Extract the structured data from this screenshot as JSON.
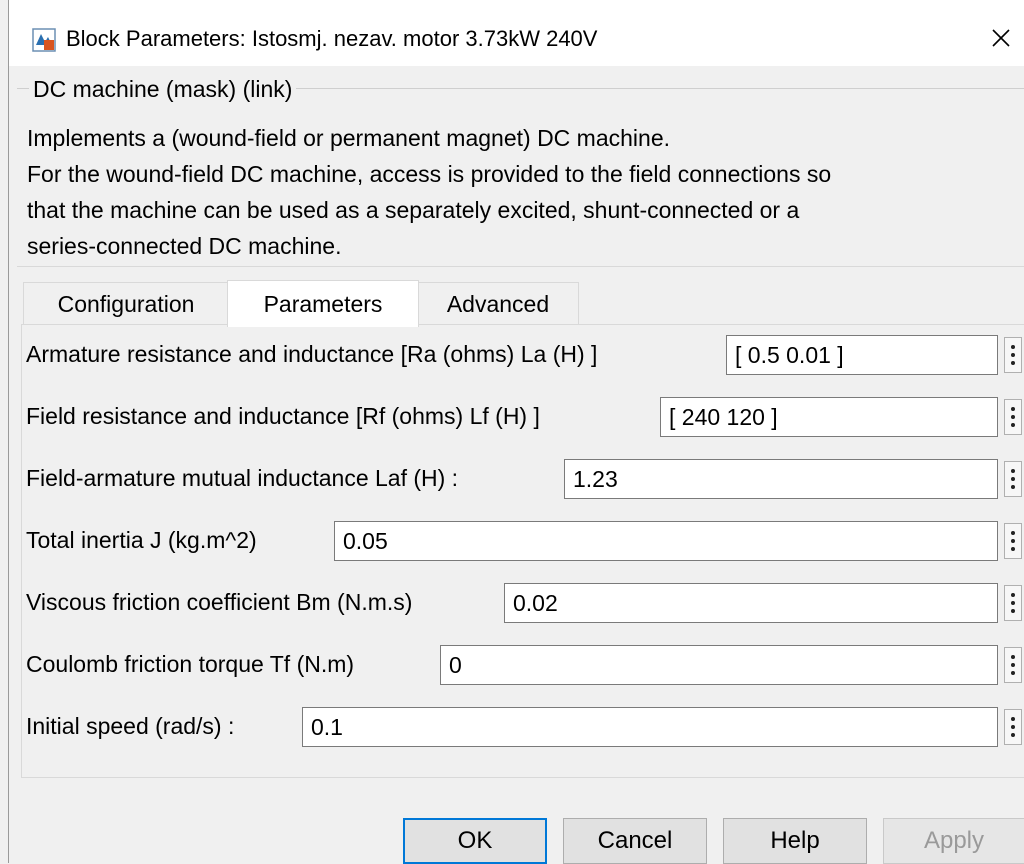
{
  "window": {
    "title": "Block Parameters: Istosmj. nezav. motor 3.73kW 240V"
  },
  "mask": {
    "group_title": "DC machine (mask) (link)",
    "description_lines": [
      "Implements a (wound-field or permanent magnet) DC machine.",
      "For the wound-field DC machine, access is provided to the field connections so",
      "that the machine can be used as a separately excited, shunt-connected or a",
      "series-connected  DC machine."
    ]
  },
  "tabs": [
    {
      "label": "Configuration",
      "active": false
    },
    {
      "label": "Parameters",
      "active": true
    },
    {
      "label": "Advanced",
      "active": false
    }
  ],
  "parameters": [
    {
      "label": "Armature resistance and inductance [Ra (ohms) La (H) ]",
      "value": "[ 0.5 0.01 ]"
    },
    {
      "label": "Field resistance and inductance [Rf (ohms) Lf (H) ]",
      "value": "[ 240 120 ]"
    },
    {
      "label": "Field-armature mutual inductance Laf (H) :",
      "value": "1.23"
    },
    {
      "label": "Total inertia J (kg.m^2)",
      "value": "0.05"
    },
    {
      "label": "Viscous friction coefficient Bm (N.m.s)",
      "value": "0.02"
    },
    {
      "label": "Coulomb friction torque Tf (N.m)",
      "value": "0"
    },
    {
      "label": "Initial speed (rad/s) :",
      "value": "0.1"
    }
  ],
  "buttons": {
    "ok": "OK",
    "cancel": "Cancel",
    "help": "Help",
    "apply": "Apply"
  },
  "icons": {
    "app": "simulink-block-icon",
    "close": "close-icon",
    "row_menu": "vertical-ellipsis-icon"
  },
  "colors": {
    "accent": "#0078d7",
    "background": "#f0f0f0",
    "field_border": "#7a7a7a"
  }
}
